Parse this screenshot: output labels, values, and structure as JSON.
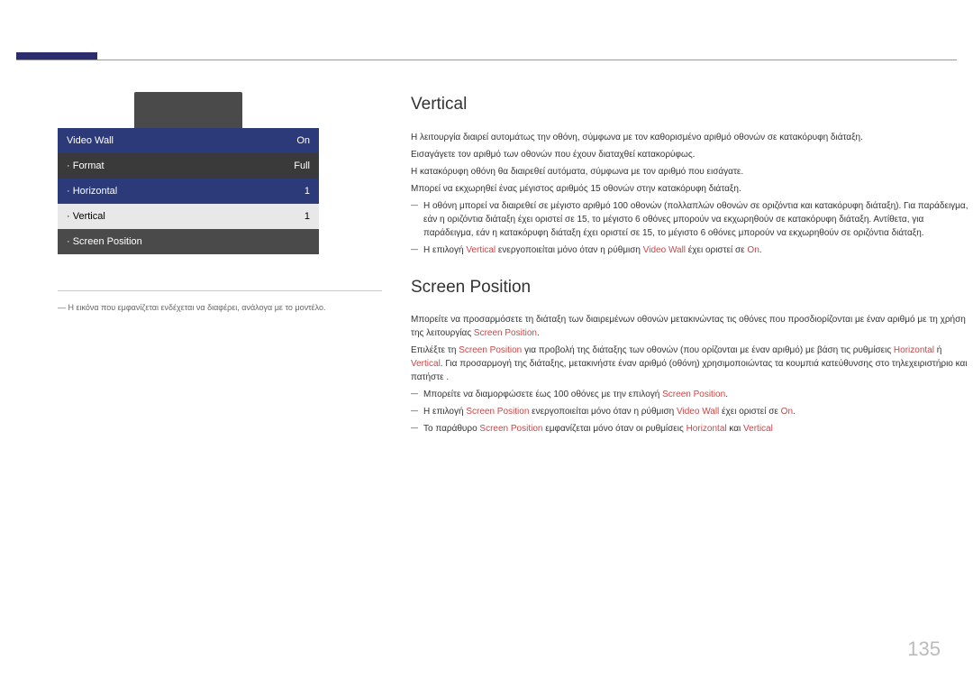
{
  "menu": {
    "videoWall": {
      "label": "Video Wall",
      "value": "On"
    },
    "format": {
      "label": "· Format",
      "value": "Full"
    },
    "horizontal": {
      "label": "· Horizontal",
      "value": "1"
    },
    "vertical": {
      "label": "· Vertical",
      "value": "1"
    },
    "screenPosition": {
      "label": "· Screen Position",
      "value": ""
    }
  },
  "note": "― Η εικόνα που εμφανίζεται ενδέχεται να διαφέρει, ανάλογα με το μοντέλο.",
  "vertical": {
    "title": "Vertical",
    "p1": "Η λειτουργία διαιρεί αυτομάτως την οθόνη, σύμφωνα με τον καθορισμένο αριθμό οθονών σε κατακόρυφη διάταξη.",
    "p2": "Εισαγάγετε τον αριθμό των οθονών που έχουν διαταχθεί κατακορύφως.",
    "p3": "Η κατακόρυφη οθόνη θα διαιρεθεί αυτόματα, σύμφωνα με τον αριθμό που εισάγατε.",
    "p4": "Μπορεί να εκχωρηθεί ένας μέγιστος αριθμός 15 οθονών στην κατακόρυφη διάταξη.",
    "b1": "Η οθόνη μπορεί να διαιρεθεί σε μέγιστο αριθμό 100 οθονών (πολλαπλών οθονών σε οριζόντια και κατακόρυφη διάταξη). Για παράδειγμα, εάν η οριζόντια διάταξη έχει οριστεί σε 15, το μέγιστο 6 οθόνες μπορούν να εκχωρηθούν σε κατακόρυφη διάταξη. Αντίθετα, για παράδειγμα, εάν η κατακόρυφη διάταξη έχει οριστεί σε 15, το μέγιστο 6 οθόνες μπορούν να εκχωρηθούν σε οριζόντια διάταξη.",
    "b2a": "Η επιλογή ",
    "b2b": "Vertical",
    "b2c": " ενεργοποιείται μόνο όταν η ρύθμιση ",
    "b2d": "Video Wall",
    "b2e": " έχει οριστεί σε ",
    "b2f": "On",
    "b2g": "."
  },
  "screenPosition": {
    "title": "Screen Position",
    "p1a": "Μπορείτε να προσαρμόσετε τη διάταξη των διαιρεμένων οθονών μετακινώντας τις οθόνες που προσδιορίζονται με έναν αριθμό με τη χρήση της λειτουργίας ",
    "p1b": "Screen Position",
    "p1c": ".",
    "p2a": "Επιλέξτε τη ",
    "p2b": "Screen Position",
    "p2c": " για προβολή της διάταξης των οθονών (που ορίζονται με έναν αριθμό) με βάση τις ρυθμίσεις ",
    "p2d": "Horizontal",
    "p2e": " ή ",
    "p2f": "Vertical",
    "p2g": ". Για προσαρμογή της διάταξης, μετακινήστε έναν αριθμό (οθόνη) χρησιμοποιώντας τα κουμπιά κατεύθυνσης στο τηλεχειριστήριο και πατήστε ",
    "p2h": ".",
    "b1a": "Μπορείτε να διαμορφώσετε έως 100 οθόνες με την επιλογή ",
    "b1b": "Screen Position",
    "b1c": ".",
    "b2a": "Η επιλογή ",
    "b2b": "Screen Position",
    "b2c": " ενεργοποιείται μόνο όταν η ρύθμιση ",
    "b2d": "Video Wall",
    "b2e": " έχει οριστεί σε ",
    "b2f": "On",
    "b2g": ".",
    "b3a": "Το παράθυρο ",
    "b3b": "Screen Position",
    "b3c": " εμφανίζεται μόνο όταν οι ρυθμίσεις ",
    "b3d": "Horizontal",
    "b3e": " και ",
    "b3f": "Vertical"
  },
  "pageNumber": "135"
}
